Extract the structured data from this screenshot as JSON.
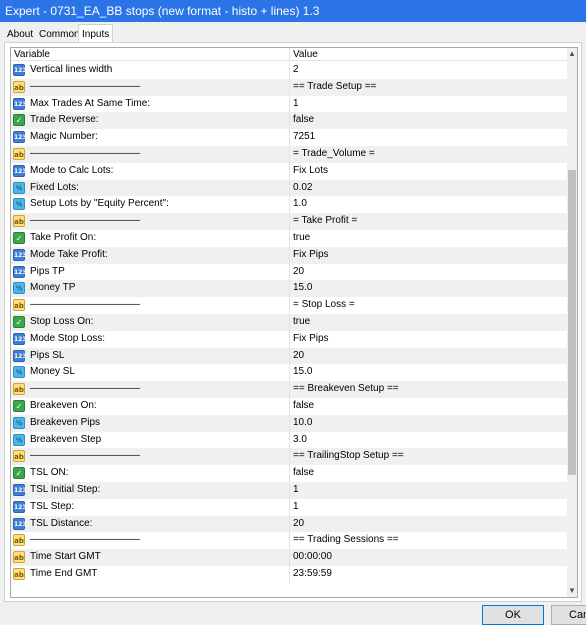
{
  "window": {
    "title": "Expert - 0731_EA_BB stops (new format - histo + lines) 1.3"
  },
  "tabs": [
    {
      "label": "About",
      "active": false
    },
    {
      "label": "Common",
      "active": false
    },
    {
      "label": "Inputs",
      "active": true
    }
  ],
  "table": {
    "header_variable": "Variable",
    "header_value": "Value",
    "rows": [
      {
        "type": "int",
        "name": "Vertical lines width",
        "value": "2"
      },
      {
        "type": "str",
        "name": "———————————",
        "value": "== Trade Setup =="
      },
      {
        "type": "int",
        "name": "Max Trades At Same Time:",
        "value": "1"
      },
      {
        "type": "bool",
        "name": "Trade Reverse:",
        "value": "false"
      },
      {
        "type": "int",
        "name": "Magic Number:",
        "value": "7251"
      },
      {
        "type": "str",
        "name": "———————————",
        "value": "= Trade_Volume ="
      },
      {
        "type": "int",
        "name": "Mode to Calc Lots:",
        "value": "Fix Lots"
      },
      {
        "type": "dbl",
        "name": "Fixed Lots:",
        "value": "0.02"
      },
      {
        "type": "dbl",
        "name": "Setup Lots by \"Equity Percent\":",
        "value": "1.0"
      },
      {
        "type": "str",
        "name": "———————————",
        "value": "= Take Profit ="
      },
      {
        "type": "bool",
        "name": "Take Profit On:",
        "value": "true"
      },
      {
        "type": "int",
        "name": "Mode Take Profit:",
        "value": "Fix Pips"
      },
      {
        "type": "int",
        "name": "Pips TP",
        "value": "20"
      },
      {
        "type": "dbl",
        "name": "Money TP",
        "value": "15.0"
      },
      {
        "type": "str",
        "name": "———————————",
        "value": "= Stop Loss ="
      },
      {
        "type": "bool",
        "name": "Stop Loss On:",
        "value": "true"
      },
      {
        "type": "int",
        "name": "Mode Stop Loss:",
        "value": "Fix Pips"
      },
      {
        "type": "int",
        "name": "Pips SL",
        "value": "20"
      },
      {
        "type": "dbl",
        "name": "Money SL",
        "value": "15.0"
      },
      {
        "type": "str",
        "name": "———————————",
        "value": "== Breakeven Setup =="
      },
      {
        "type": "bool",
        "name": "Breakeven On:",
        "value": "false"
      },
      {
        "type": "dbl",
        "name": "Breakeven Pips",
        "value": "10.0"
      },
      {
        "type": "dbl",
        "name": "Breakeven Step",
        "value": "3.0"
      },
      {
        "type": "str",
        "name": "———————————",
        "value": "== TrailingStop Setup =="
      },
      {
        "type": "bool",
        "name": "TSL ON:",
        "value": "false"
      },
      {
        "type": "int",
        "name": "TSL Initial Step:",
        "value": "1"
      },
      {
        "type": "int",
        "name": "TSL Step:",
        "value": "1"
      },
      {
        "type": "int",
        "name": "TSL Distance:",
        "value": "20"
      },
      {
        "type": "str",
        "name": "———————————",
        "value": "== Trading Sessions =="
      },
      {
        "type": "str",
        "name": "Time Start GMT",
        "value": "00:00:00"
      },
      {
        "type": "str",
        "name": "Time End GMT",
        "value": "23:59:59"
      }
    ]
  },
  "icons": {
    "int": "123",
    "str": "ab",
    "bool": "✓",
    "dbl": "½"
  },
  "scrollbar": {
    "position_fraction": 0.5,
    "up_arrow": "▲",
    "down_arrow": "▼"
  },
  "buttons": {
    "ok_label": "OK",
    "cancel_label": "Cancel"
  }
}
